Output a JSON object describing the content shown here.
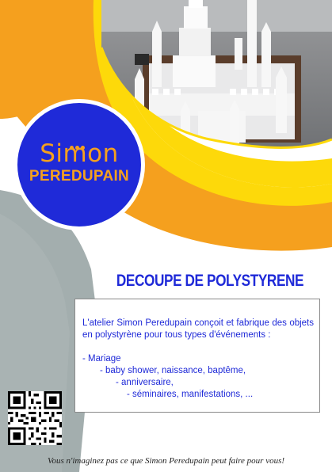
{
  "brand": {
    "name_top": "Simon",
    "name_bottom": "PEREDUPAIN",
    "color_blue": "#1f2ad8",
    "color_orange": "#f5a01e",
    "color_yellow": "#fdd90a",
    "color_gray": "#a3aeae"
  },
  "headline": "DECOUPE DE POLYSTYRENE",
  "body": {
    "intro": "L'atelier Simon Peredupain conçoit et fabrique des objets en polystyrène pour tous types d'événements :",
    "list": [
      "- Mariage",
      "- baby shower, naissance, baptême,",
      "- anniversaire,",
      "- séminaires, manifestations, ..."
    ]
  },
  "qr_code": "qr-code-icon",
  "photo": "polystyrene-castle-cake-photo",
  "footer": "Vous n'imaginez pas ce que Simon Peredupain peut faire pour vous!"
}
